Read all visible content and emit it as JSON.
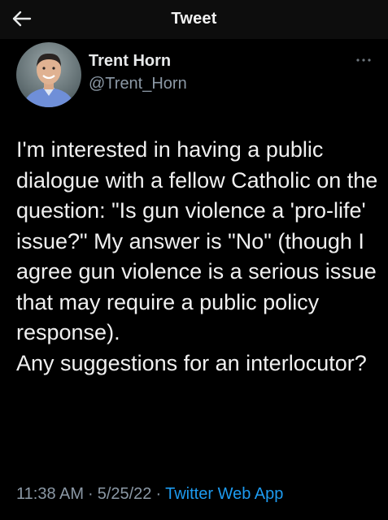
{
  "header": {
    "title": "Tweet",
    "back_icon": "arrow-left-icon"
  },
  "author": {
    "display_name": "Trent Horn",
    "handle": "@Trent_Horn",
    "avatar_icon": "profile-photo",
    "more_icon": "more-horizontal-icon"
  },
  "tweet": {
    "text": "I'm interested in having a public dialogue with a fellow Catholic on the question: \"Is gun violence a 'pro-life' issue?\" My answer is \"No\" (though I agree gun violence is a serious issue that may require a public policy response).\nAny suggestions for an interlocutor?"
  },
  "meta": {
    "time": "11:38 AM",
    "date": "5/25/22",
    "separator": "·",
    "source": "Twitter Web App"
  },
  "colors": {
    "background": "#000000",
    "text": "#e7e9ea",
    "secondary": "#8b98a5",
    "accent": "#1d9bf0"
  }
}
